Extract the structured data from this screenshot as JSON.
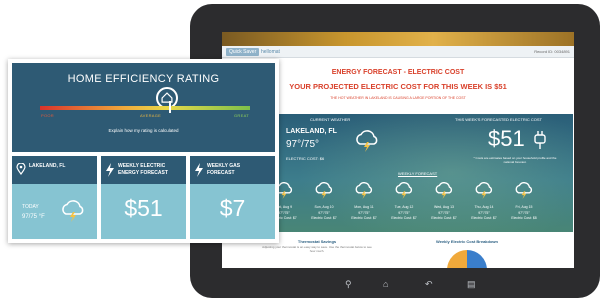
{
  "card": {
    "title": "HOME EFFICIENCY RATING",
    "rating": {
      "poor": "POOR",
      "average": "AVERAGE",
      "great": "GREAT",
      "level": 0.62
    },
    "explain_link": "Explain how my rating is calculated",
    "tiles": [
      {
        "name_line1": "LAKELAND, FL",
        "name_line2": "",
        "today_label": "TODAY",
        "today_temp": "97/75 °F",
        "icon": "location-pin-icon"
      },
      {
        "name_line1": "WEEKLY ELECTRIC",
        "name_line2": "ENERGY FORECAST",
        "value": "$51",
        "icon": "lightning-icon"
      },
      {
        "name_line1": "WEEKLY GAS",
        "name_line2": "FORECAST",
        "value": "$7",
        "icon": "lightning-icon"
      }
    ]
  },
  "tablet": {
    "nav": {
      "tab1": "Quick Saver",
      "tab2": "hellomat",
      "record": "Record ID: 0034891"
    },
    "heading": "ENERGY FORECAST - ELECTRIC COST",
    "cost_line": "YOUR PROJECTED ELECTRIC COST FOR THIS WEEK IS $51",
    "note": "THE HOT WEATHER IN LAKELAND IS CAUSING A LARGE PORTION OF THE COST",
    "current_weather_title": "CURRENT WEATHER",
    "location": "LAKELAND, FL",
    "temp": "97°/75°",
    "electric_cost": "ELECTRIC COST: $6",
    "weekly_forecast_title": "THIS WEEK'S FORECASTED ELECTRIC COST",
    "weekly_value": "$51",
    "weekly_note": "* Costs are estimates based on your household profile and the national forecast.",
    "weekly_forecast_link": "WEEKLY FORECAST",
    "days": [
      {
        "day": "Sat, Aug 9",
        "temp": "97°/75°",
        "cost": "Electric Cost: $7"
      },
      {
        "day": "Sun, Aug 10",
        "temp": "97°/75°",
        "cost": "Electric Cost: $7"
      },
      {
        "day": "Mon, Aug 11",
        "temp": "97°/75°",
        "cost": "Electric Cost: $7"
      },
      {
        "day": "Tue, Aug 12",
        "temp": "97°/75°",
        "cost": "Electric Cost: $7"
      },
      {
        "day": "Wed, Aug 13",
        "temp": "97°/75°",
        "cost": "Electric Cost: $7"
      },
      {
        "day": "Thu, Aug 14",
        "temp": "97°/75°",
        "cost": "Electric Cost: $7"
      },
      {
        "day": "Fri, Aug 15",
        "temp": "97°/75°",
        "cost": "Electric Cost: $8"
      }
    ],
    "thermostat_title": "Thermostat Savings",
    "thermostat_text": "Adjusting your thermostat is an easy way to save. Use the thermostat below to see how much.",
    "breakdown_title": "Weekly Electric Cost Breakdown"
  },
  "colors": {
    "accent_red": "#d9412b",
    "panel_blue": "#2e5a74",
    "tile_blue": "#86c4d2"
  }
}
